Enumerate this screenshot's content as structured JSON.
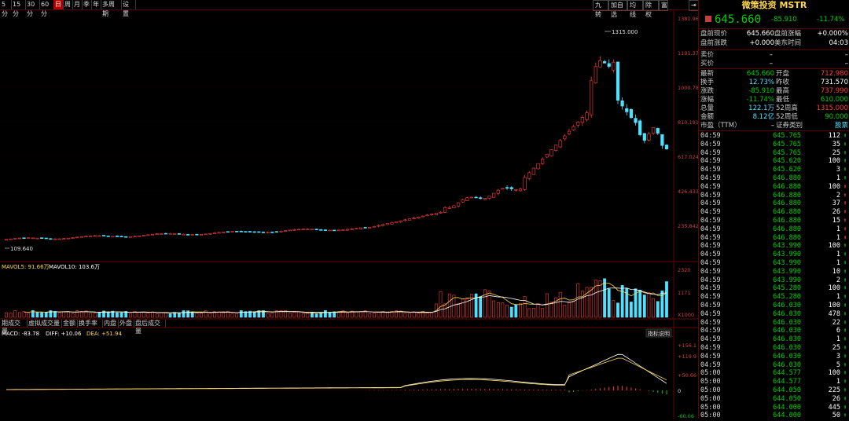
{
  "toolbar": {
    "periods": [
      "5分",
      "15分",
      "30分",
      "60分",
      "日",
      "周",
      "月",
      "季",
      "年",
      "多周期",
      "设置"
    ],
    "active": "日",
    "right": [
      "九转",
      "加自选",
      "均线",
      "除权",
      "富"
    ]
  },
  "main_chart": {
    "price_labels": [
      "1381.964",
      "1191.373",
      "1000.782",
      "810.191",
      "617.024",
      "426.433",
      "235.842"
    ],
    "peak_label": "1315.000",
    "low_label": "109.640"
  },
  "volume_chart": {
    "legend_mavol5": "MAVOL5: 91.66万",
    "legend_mavol10": "MAVOL10: 103.6万",
    "axis_labels": [
      "2320",
      "1171",
      "X1000"
    ]
  },
  "indicator_tabs": [
    "期成交量",
    "虚拟成交量",
    "金额",
    "换手率",
    "内盘",
    "外盘",
    "盘后成交量"
  ],
  "macd": {
    "label_macd": "MACD: -83.78",
    "label_diff": "DIFF: +10.06",
    "label_dea": "DEA: +51.94",
    "help": "指标说明",
    "axis_labels": [
      "+156.1",
      "+119.9",
      "+50.66",
      "0",
      "-60.06"
    ]
  },
  "chart_data": {
    "type": "table",
    "title": "",
    "candles_note": "",
    "volume_peak": 2320,
    "macd_range": [
      -60.06,
      156.1
    ]
  },
  "panel": {
    "title": "微策投资 MSTR",
    "price": "645.660",
    "change": "-85.910",
    "change_pct": "-11.74%",
    "pre": [
      {
        "l1": "盘前现价",
        "v1": "645.660",
        "l2": "盘前涨幅",
        "v2": "+0.000%"
      },
      {
        "l1": "盘前涨跌",
        "v1": "+0.000",
        "l2": "美东时间",
        "v2": "04:03"
      }
    ],
    "buy_sell": [
      {
        "l": "卖价",
        "v": "–",
        "v2": "–"
      },
      {
        "l": "买价",
        "v": "–",
        "v2": "–"
      }
    ],
    "stats": [
      {
        "l1": "最新",
        "v1": "645.660",
        "c1": "green",
        "l2": "开盘",
        "v2": "712.980",
        "c2": "red"
      },
      {
        "l1": "换手",
        "v1": "12.73%",
        "c1": "cyan",
        "l2": "昨收",
        "v2": "731.570",
        "c2": "white"
      },
      {
        "l1": "涨跌",
        "v1": "-85.910",
        "c1": "green",
        "l2": "最高",
        "v2": "737.990",
        "c2": "red"
      },
      {
        "l1": "涨幅",
        "v1": "-11.74%",
        "c1": "green",
        "l2": "最低",
        "v2": "610.000",
        "c2": "green"
      },
      {
        "l1": "总量",
        "v1": "122.1万",
        "c1": "cyan",
        "l2": "52周高",
        "v2": "1315.000",
        "c2": "red"
      },
      {
        "l1": "金额",
        "v1": "8.12亿",
        "c1": "cyan",
        "l2": "52周低",
        "v2": "90.000",
        "c2": "green"
      },
      {
        "l1": "市盈（TTM）",
        "v1": "–",
        "c1": "white",
        "l2": "证券类别",
        "v2": "股票",
        "c2": "cyan"
      }
    ],
    "ticks": [
      {
        "t": "04:59",
        "p": "645.765",
        "v": "112",
        "d": "up"
      },
      {
        "t": "04:59",
        "p": "645.765",
        "v": "35",
        "d": "up"
      },
      {
        "t": "04:59",
        "p": "645.765",
        "v": "25",
        "d": "up"
      },
      {
        "t": "04:59",
        "p": "645.620",
        "v": "100",
        "d": "up"
      },
      {
        "t": "04:59",
        "p": "645.620",
        "v": "3",
        "d": "up"
      },
      {
        "t": "04:59",
        "p": "646.880",
        "v": "1",
        "d": "up"
      },
      {
        "t": "04:59",
        "p": "646.880",
        "v": "100",
        "d": "down"
      },
      {
        "t": "04:59",
        "p": "646.880",
        "v": "2",
        "d": "down"
      },
      {
        "t": "04:59",
        "p": "646.880",
        "v": "37",
        "d": "down"
      },
      {
        "t": "04:59",
        "p": "646.880",
        "v": "26",
        "d": "down"
      },
      {
        "t": "04:59",
        "p": "646.880",
        "v": "15",
        "d": "down"
      },
      {
        "t": "04:59",
        "p": "646.880",
        "v": "1",
        "d": "down"
      },
      {
        "t": "04:59",
        "p": "646.880",
        "v": "1",
        "d": "down"
      },
      {
        "t": "04:59",
        "p": "643.990",
        "v": "100",
        "d": "up"
      },
      {
        "t": "04:59",
        "p": "643.990",
        "v": "1",
        "d": "up"
      },
      {
        "t": "04:59",
        "p": "643.990",
        "v": "1",
        "d": "up"
      },
      {
        "t": "04:59",
        "p": "643.990",
        "v": "10",
        "d": "up"
      },
      {
        "t": "04:59",
        "p": "643.990",
        "v": "2",
        "d": "up"
      },
      {
        "t": "04:59",
        "p": "645.280",
        "v": "100",
        "d": "up"
      },
      {
        "t": "04:59",
        "p": "645.280",
        "v": "1",
        "d": "up"
      },
      {
        "t": "04:59",
        "p": "646.030",
        "v": "100",
        "d": "up"
      },
      {
        "t": "04:59",
        "p": "646.030",
        "v": "478",
        "d": "up"
      },
      {
        "t": "04:59",
        "p": "646.030",
        "v": "22",
        "d": "up"
      },
      {
        "t": "04:59",
        "p": "646.030",
        "v": "6",
        "d": "up"
      },
      {
        "t": "04:59",
        "p": "646.030",
        "v": "1",
        "d": "up"
      },
      {
        "t": "04:59",
        "p": "646.030",
        "v": "25",
        "d": "up"
      },
      {
        "t": "04:59",
        "p": "646.030",
        "v": "3",
        "d": "up"
      },
      {
        "t": "04:59",
        "p": "646.030",
        "v": "5",
        "d": "up"
      },
      {
        "t": "05:00",
        "p": "644.577",
        "v": "100",
        "d": "up"
      },
      {
        "t": "05:00",
        "p": "644.577",
        "v": "1",
        "d": "up"
      },
      {
        "t": "05:00",
        "p": "644.050",
        "v": "225",
        "d": "up"
      },
      {
        "t": "05:00",
        "p": "644.050",
        "v": "26",
        "d": "up"
      },
      {
        "t": "05:00",
        "p": "644.000",
        "v": "445",
        "d": "up"
      },
      {
        "t": "05:00",
        "p": "644.000",
        "v": "50",
        "d": "up"
      }
    ]
  }
}
